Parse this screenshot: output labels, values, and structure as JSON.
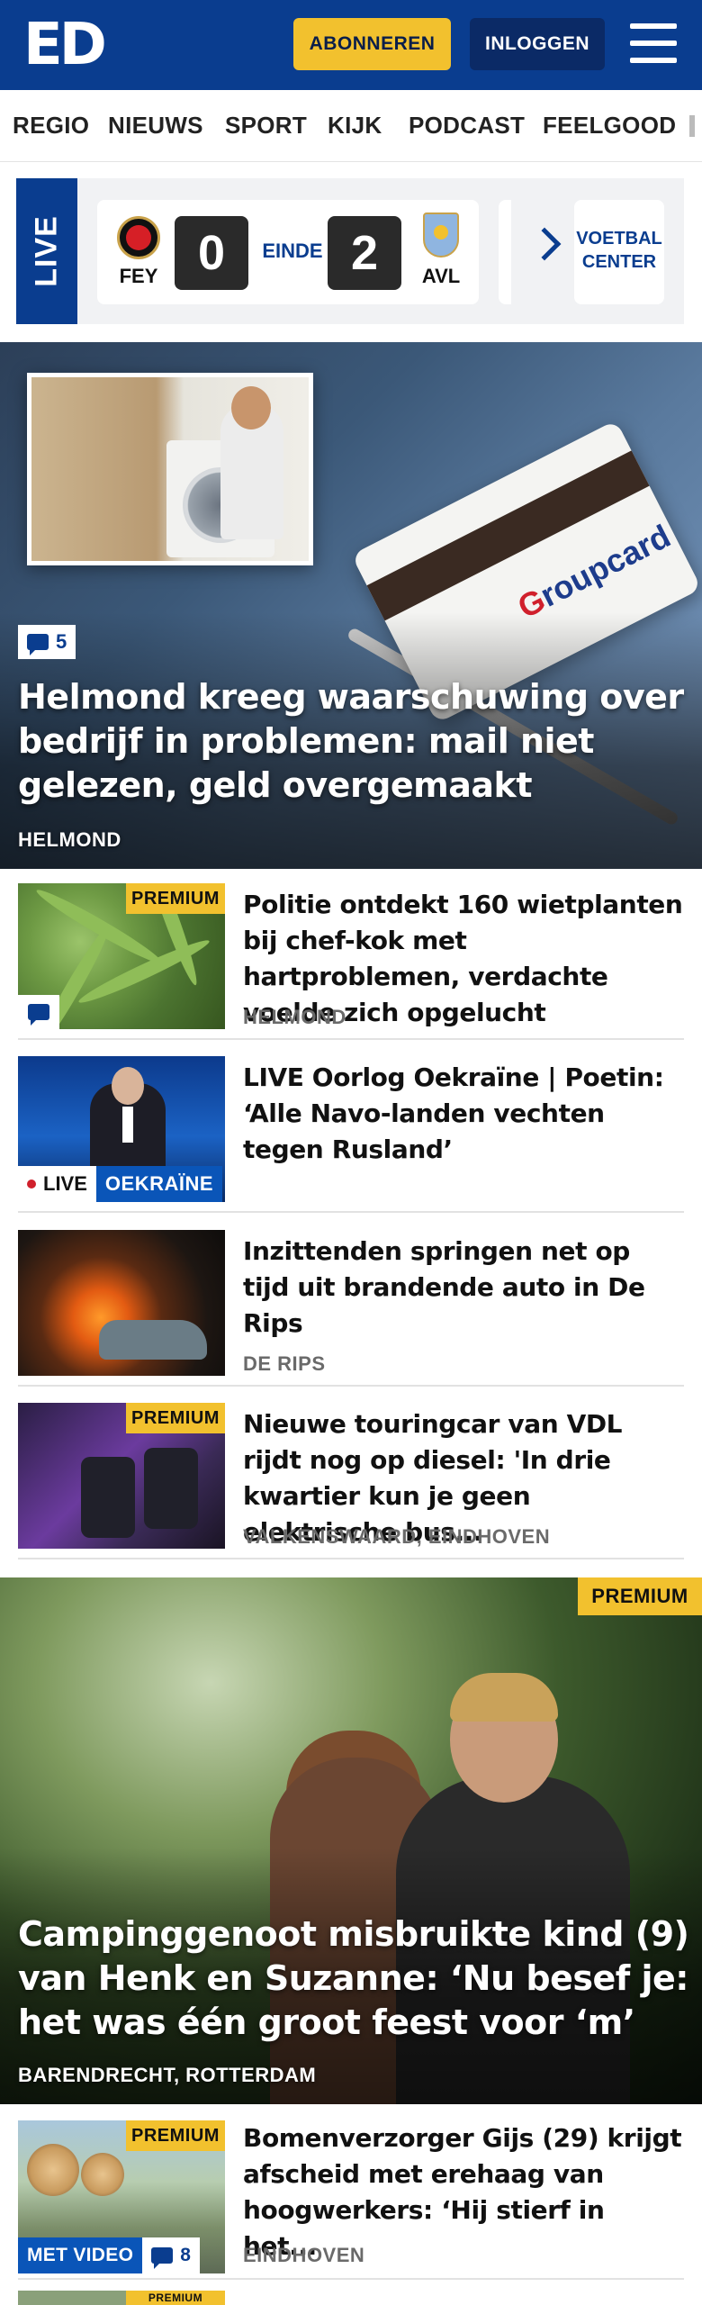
{
  "header": {
    "logo": "ED",
    "subscribe_label": "ABONNEREN",
    "login_label": "INLOGGEN",
    "menu_icon": "hamburger-icon",
    "background": "#0a3d8f",
    "accent": "#f2c12e"
  },
  "nav": {
    "items": [
      "REGIO",
      "NIEUWS",
      "SPORT",
      "KIJK",
      "PODCAST",
      "FEELGOOD"
    ]
  },
  "live_score": {
    "tab_label": "LIVE",
    "home_team": "FEY",
    "home_score": "0",
    "status": "EINDE",
    "away_score": "2",
    "away_team": "AVL",
    "voetbal_center_label": "VOETBAL CENTER"
  },
  "hero1": {
    "comment_count": "5",
    "card_brand": "Groupcard",
    "title": "Helmond kreeg waarschuwing over bedrijf in problemen: mail niet gelezen, geld overgemaakt",
    "location": "HELMOND"
  },
  "articles": [
    {
      "badge": "PREMIUM",
      "title": "Politie ontdekt 160 wietplanten bij chef-kok met hartproblemen, verdachte voelde zich opgelucht",
      "location": "HELMOND"
    },
    {
      "live_label": "LIVE",
      "topic": "OEKRAÏNE",
      "title": "LIVE Oorlog Oekraïne | Poetin: ‘Alle Navo-landen vechten tegen Rusland’"
    },
    {
      "title": "Inzittenden springen net op tijd uit brandende auto in De Rips",
      "location": "DE RIPS"
    },
    {
      "badge": "PREMIUM",
      "title": "Nieuwe touringcar van VDL rijdt nog op diesel: 'In drie kwartier kun je geen elektrische bus...",
      "location": "VALKENSWAARD, EINDHOVEN"
    }
  ],
  "hero2": {
    "badge": "PREMIUM",
    "title": "Campinggenoot misbruikte kind (9) van Henk en Suzanne: ‘Nu besef je: het was één groot feest voor ‘m’",
    "location": "BARENDRECHT, ROTTERDAM"
  },
  "article5": {
    "badge": "PREMIUM",
    "video_label": "MET VIDEO",
    "comment_count": "8",
    "title": "Bomenverzorger Gijs (29) krijgt afscheid met erehaag van hoogwerkers: ‘Hij stierf in het...",
    "location": "EINDHOVEN"
  },
  "article6": {
    "badge": "PREMIUM"
  }
}
